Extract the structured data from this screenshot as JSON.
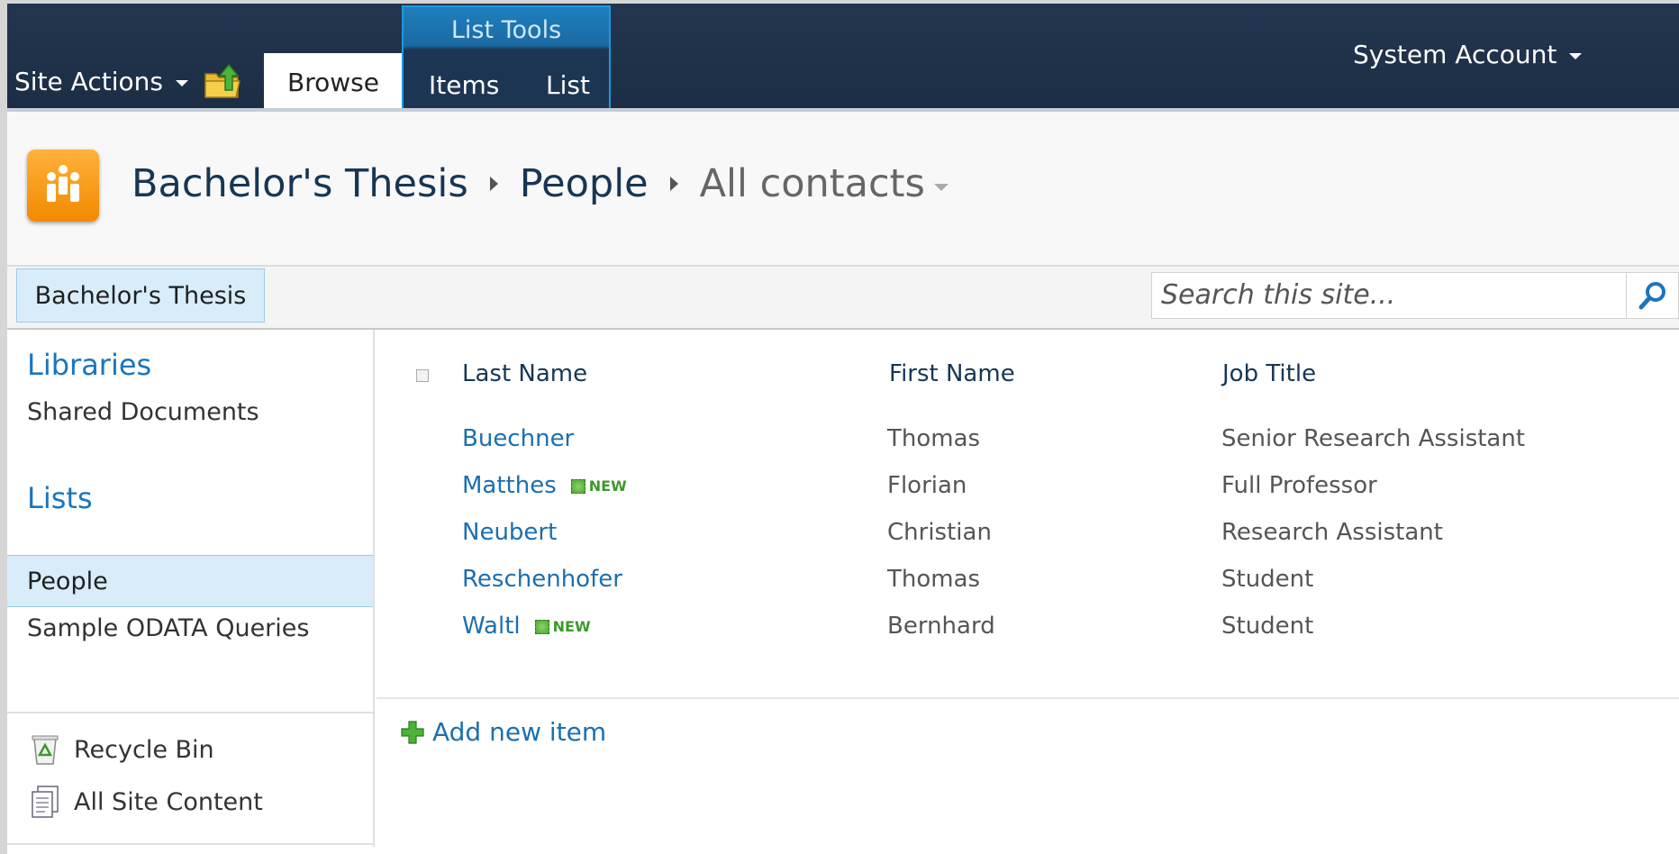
{
  "ribbon": {
    "site_actions": "Site Actions",
    "browse_tab": "Browse",
    "list_tools_label": "List Tools",
    "items_tab": "Items",
    "list_tab": "List",
    "user": "System Account"
  },
  "breadcrumb": {
    "site": "Bachelor's Thesis",
    "list": "People",
    "view": "All contacts"
  },
  "topnav": {
    "home": "Bachelor's Thesis",
    "search_placeholder": "Search this site..."
  },
  "leftnav": {
    "libraries_heading": "Libraries",
    "libraries": [
      "Shared Documents"
    ],
    "lists_heading": "Lists",
    "lists": [
      "People",
      "Sample ODATA Queries"
    ],
    "recycle_bin": "Recycle Bin",
    "all_site_content": "All Site Content"
  },
  "list": {
    "columns": [
      "Last Name",
      "First Name",
      "Job Title"
    ],
    "new_label": "NEW",
    "rows": [
      {
        "last": "Buechner",
        "first": "Thomas",
        "title": "Senior Research Assistant",
        "is_new": false
      },
      {
        "last": "Matthes",
        "first": "Florian",
        "title": "Full Professor",
        "is_new": true
      },
      {
        "last": "Neubert",
        "first": "Christian",
        "title": "Research Assistant",
        "is_new": false
      },
      {
        "last": "Reschenhofer",
        "first": "Thomas",
        "title": "Student",
        "is_new": false
      },
      {
        "last": "Waltl",
        "first": "Bernhard",
        "title": "Student",
        "is_new": true
      }
    ],
    "add_new": "Add new item"
  },
  "colors": {
    "ribbon_bg": "#1c2e45",
    "link_blue": "#1b6fb0",
    "nav_selected": "#d8ecfa",
    "logo_orange": "#f28a00",
    "new_green": "#3c9a2a"
  }
}
